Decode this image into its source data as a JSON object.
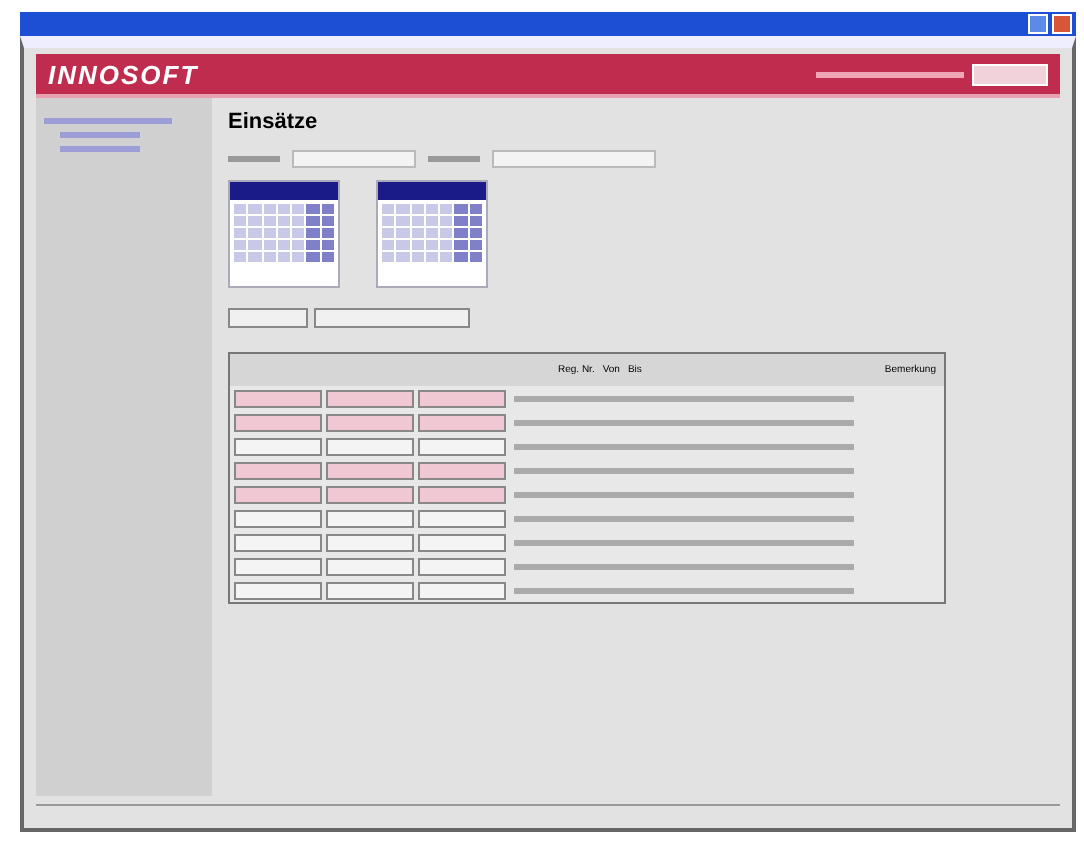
{
  "header": {
    "logo": "INNOSOFT"
  },
  "page": {
    "title": "Einsätze"
  },
  "calendars": [
    {
      "days_marked": true
    },
    {
      "days_marked": true
    }
  ],
  "table": {
    "columns": [
      "Reg. Nr.",
      "Von",
      "Bis",
      "Bemerkung"
    ],
    "rows": [
      {
        "highlighted": true
      },
      {
        "highlighted": true
      },
      {
        "highlighted": false
      },
      {
        "highlighted": true
      },
      {
        "highlighted": true
      },
      {
        "highlighted": false
      },
      {
        "highlighted": false
      },
      {
        "highlighted": false
      },
      {
        "highlighted": false
      }
    ]
  }
}
